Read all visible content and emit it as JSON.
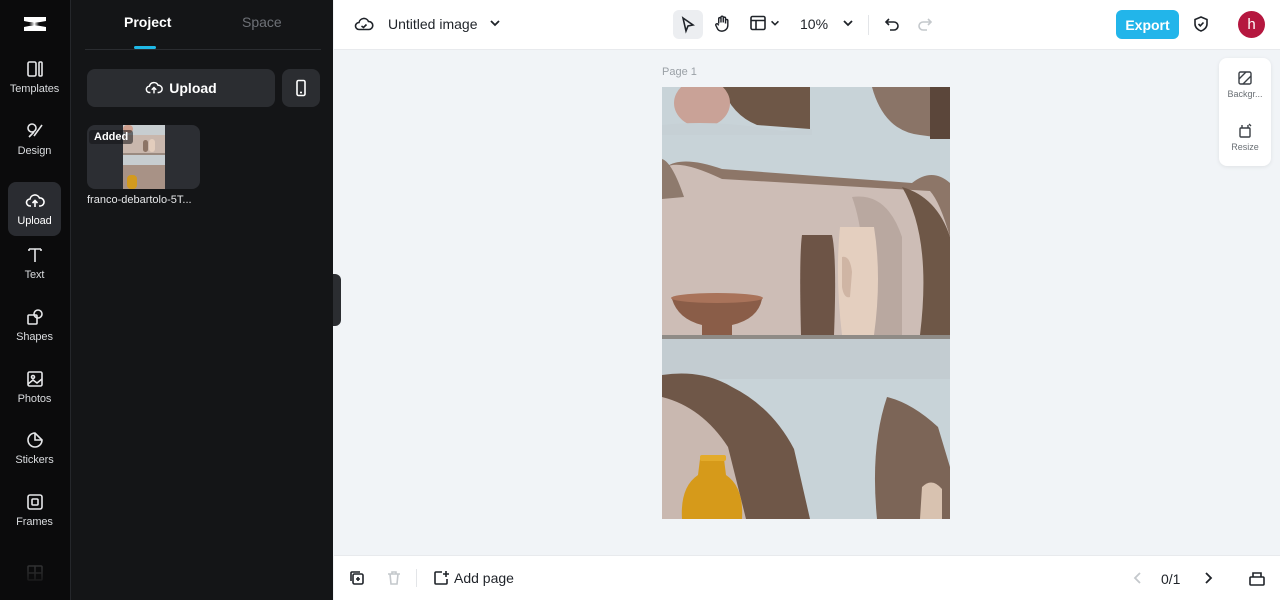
{
  "rail": {
    "items": [
      {
        "label": "Templates",
        "icon": "templates-icon"
      },
      {
        "label": "Design",
        "icon": "design-icon"
      },
      {
        "label": "Upload",
        "icon": "upload-cloud-icon",
        "active": true
      },
      {
        "label": "Text",
        "icon": "text-icon"
      },
      {
        "label": "Shapes",
        "icon": "shapes-icon"
      },
      {
        "label": "Photos",
        "icon": "photos-icon"
      },
      {
        "label": "Stickers",
        "icon": "stickers-icon"
      },
      {
        "label": "Frames",
        "icon": "frames-icon"
      }
    ]
  },
  "panel": {
    "tabs": [
      {
        "label": "Project",
        "active": true
      },
      {
        "label": "Space"
      }
    ],
    "upload_label": "Upload",
    "assets": [
      {
        "badge": "Added",
        "name": "franco-debartolo-5T..."
      }
    ]
  },
  "topbar": {
    "title": "Untitled image",
    "zoom": "10%",
    "export_label": "Export",
    "avatar_initial": "h"
  },
  "canvas": {
    "page_label": "Page 1"
  },
  "side_tools": [
    {
      "label": "Backgr...",
      "icon": "background-icon"
    },
    {
      "label": "Resize",
      "icon": "resize-icon"
    }
  ],
  "bottombar": {
    "add_page_label": "Add page",
    "page_count": "0/1"
  },
  "colors": {
    "accent": "#22b5ea",
    "avatar": "#b5173f",
    "rail_bg": "#0b0b0c",
    "panel_bg": "#141517"
  }
}
